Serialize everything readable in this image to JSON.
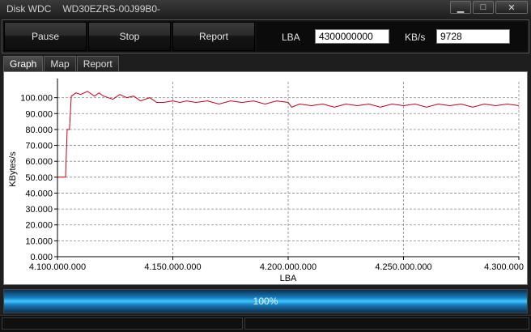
{
  "window": {
    "app_title": "Disk WDC",
    "drive_model": "WD30EZRS-00J99B0-",
    "minimize_glyph": "▁",
    "maximize_glyph": "□",
    "close_glyph": "✕"
  },
  "toolbar": {
    "pause_label": "Pause",
    "stop_label": "Stop",
    "report_label": "Report",
    "lba_label": "LBA",
    "lba_value": "4300000000",
    "speed_label": "KB/s",
    "speed_value": "9728"
  },
  "tabs": [
    {
      "label": "Graph",
      "active": true
    },
    {
      "label": "Map",
      "active": false
    },
    {
      "label": "Report",
      "active": false
    }
  ],
  "progress": {
    "text": "100%",
    "value": 100
  },
  "colors": {
    "series": "#c0001a",
    "grid": "#888888",
    "plot_bg": "#ffffff"
  },
  "chart_data": {
    "type": "line",
    "xlabel": "LBA",
    "ylabel": "KBytes/s",
    "xlim": [
      4100000000,
      4300000000
    ],
    "ylim": [
      0,
      110
    ],
    "x_ticks": [
      4100000000,
      4150000000,
      4200000000,
      4250000000,
      4300000000
    ],
    "x_tick_labels": [
      "4.100.000.000",
      "4.150.000.000",
      "4.200.000.000",
      "4.250.000.000",
      "4.300.000"
    ],
    "y_ticks": [
      0,
      10,
      20,
      30,
      40,
      50,
      60,
      70,
      80,
      90,
      100
    ],
    "y_tick_labels": [
      "0.000",
      "10.000",
      "20.000",
      "30.000",
      "40.000",
      "50.000",
      "60.000",
      "70.000",
      "80.000",
      "90.000",
      "100.000"
    ],
    "grid": true,
    "series": [
      {
        "x": [
          4100000000,
          4103500000,
          4104200000,
          4105200000,
          4106000000,
          4108000000,
          4110000000,
          4113000000,
          4116000000,
          4118000000,
          4120000000,
          4124000000,
          4127000000,
          4130000000,
          4133000000,
          4136000000,
          4140000000,
          4143000000,
          4146000000,
          4150000000,
          4153000000,
          4156000000,
          4160000000,
          4165000000,
          4170000000,
          4175000000,
          4180000000,
          4185000000,
          4190000000,
          4195000000,
          4200000000,
          4201500000,
          4205000000,
          4210000000,
          4215000000,
          4220000000,
          4225000000,
          4230000000,
          4235000000,
          4240000000,
          4245000000,
          4250000000,
          4255000000,
          4260000000,
          4265000000,
          4270000000,
          4275000000,
          4280000000,
          4285000000,
          4290000000,
          4295000000,
          4300000000
        ],
        "y": [
          50,
          50,
          80,
          80,
          101,
          103,
          102,
          104,
          101,
          103,
          101,
          99,
          102,
          100,
          101,
          98,
          100,
          97,
          97,
          98,
          97,
          98,
          97,
          98,
          96,
          98,
          97,
          98,
          96,
          98,
          97,
          94,
          96,
          95,
          96,
          94,
          96,
          95,
          96,
          94,
          96,
          95,
          96,
          94,
          96,
          95,
          96,
          94,
          96,
          95,
          96,
          95
        ]
      }
    ]
  }
}
